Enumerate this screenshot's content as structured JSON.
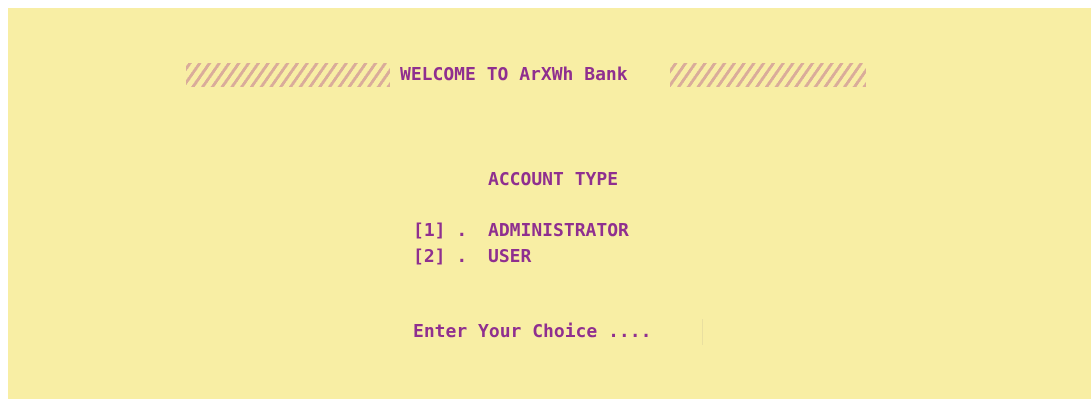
{
  "banner": {
    "title": "WELCOME TO ArXWh Bank"
  },
  "menu": {
    "heading": "ACCOUNT TYPE",
    "options": [
      {
        "key": "[1] .",
        "label": "ADMINISTRATOR"
      },
      {
        "key": "[2] .",
        "label": "USER"
      }
    ]
  },
  "prompt": {
    "text": "Enter Your Choice ....",
    "input_value": ""
  },
  "colors": {
    "background": "#f8eea4",
    "text": "#8f2f8f",
    "hatch": "#d8a99a"
  }
}
